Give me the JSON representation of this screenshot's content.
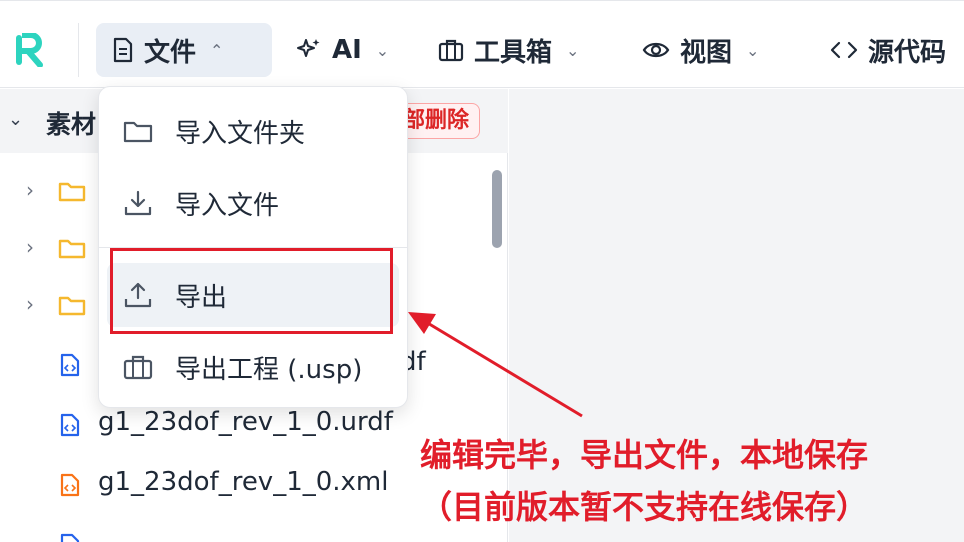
{
  "toolbar": {
    "logo_label": "R",
    "menus": [
      {
        "label": "文件",
        "icon": "file-icon"
      },
      {
        "label": "AI",
        "icon": "sparkles-icon"
      },
      {
        "label": "工具箱",
        "icon": "toolbox-icon"
      },
      {
        "label": "视图",
        "icon": "eye-icon"
      },
      {
        "label": "源代码",
        "icon": "code-icon"
      }
    ]
  },
  "sidebar": {
    "title": "素材",
    "delete_all_label": "部删除",
    "items": [
      {
        "name": "",
        "type": "folder"
      },
      {
        "name": "",
        "type": "folder"
      },
      {
        "name": "",
        "type": "folder"
      },
      {
        "name": "df",
        "type": "urdf"
      },
      {
        "name": "g1_23dof_rev_1_0.urdf",
        "type": "urdf"
      },
      {
        "name": "g1_23dof_rev_1_0.xml",
        "type": "xml"
      }
    ]
  },
  "file_menu": {
    "items": [
      {
        "label": "导入文件夹",
        "icon": "folder-icon"
      },
      {
        "label": "导入文件",
        "icon": "download-icon"
      },
      {
        "label": "导出",
        "icon": "upload-icon"
      },
      {
        "label": "导出工程 (.usp)",
        "icon": "briefcase-icon"
      }
    ]
  },
  "annotation": {
    "line1": "编辑完毕，导出文件，本地保存",
    "line2": "（目前版本暂不支持在线保存）"
  },
  "colors": {
    "accent": "#2dd4bf",
    "annotation": "#e11d2a",
    "folder": "#f5b82e",
    "urdf_icon": "#2563eb",
    "xml_icon": "#f97316"
  }
}
